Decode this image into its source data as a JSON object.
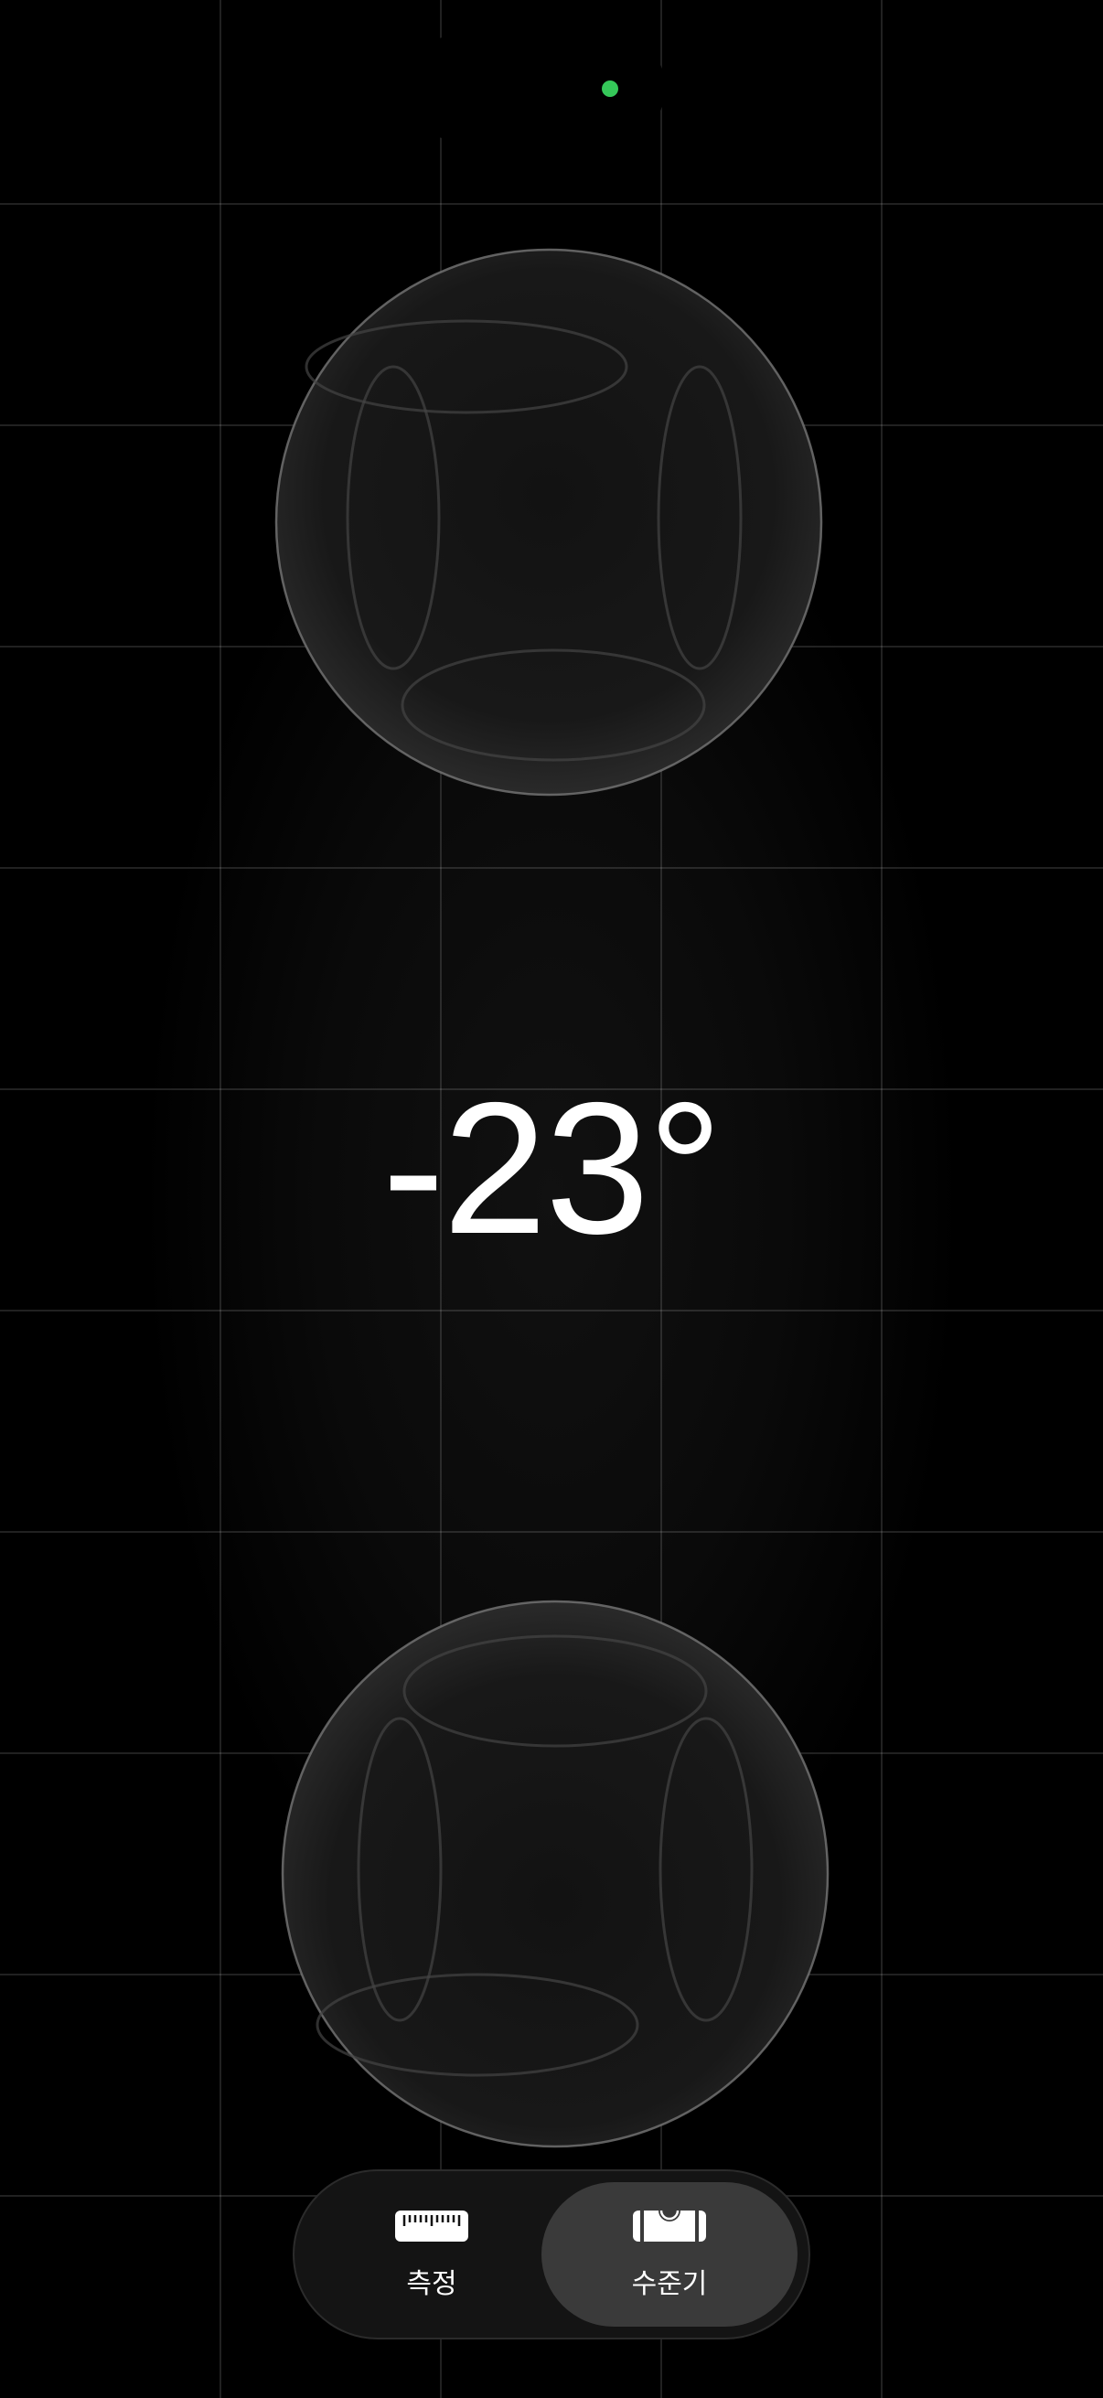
{
  "level": {
    "angle": "-23°"
  },
  "tabs": [
    {
      "label": "측정",
      "icon": "ruler-icon",
      "active": false
    },
    {
      "label": "수준기",
      "icon": "level-icon",
      "active": true
    }
  ],
  "colors": {
    "background": "#000000",
    "grid": "#2a2a2a",
    "camera_indicator": "#35c759",
    "active_tab": "#3a3a3a"
  }
}
